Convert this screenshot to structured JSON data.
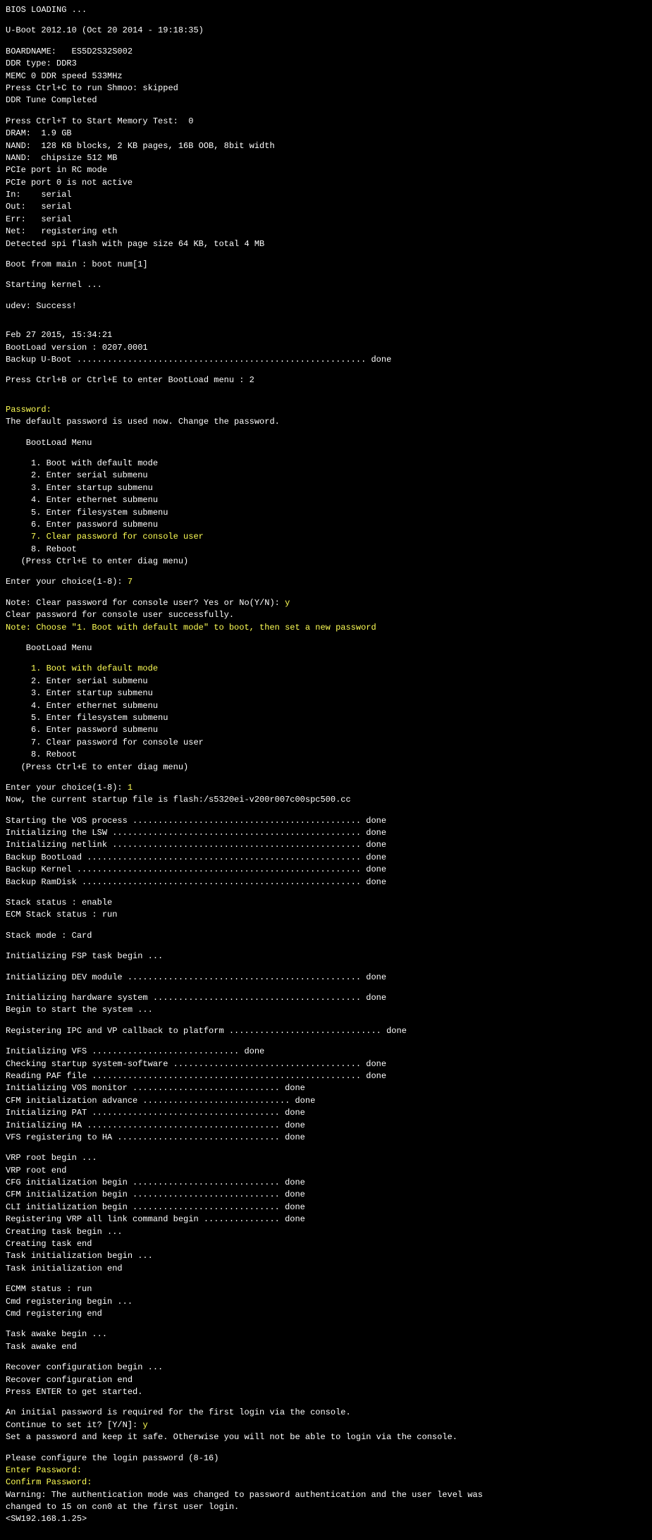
{
  "bios_loading": "BIOS LOADING ...",
  "uboot": "U-Boot 2012.10 (Oct 20 2014 - 19:18:35)",
  "boardname": "BOARDNAME:   ES5D2S32S002",
  "ddr_type": "DDR type: DDR3",
  "memc": "MEMC 0 DDR speed 533MHz",
  "press_ctrl_c": "Press Ctrl+C to run Shmoo: skipped",
  "ddr_tune": "DDR Tune Completed",
  "press_ctrl_t": "Press Ctrl+T to Start Memory Test:  0",
  "dram": "DRAM:  1.9 GB",
  "nand1": "NAND:  128 KB blocks, 2 KB pages, 16B OOB, 8bit width",
  "nand2": "NAND:  chipsize 512 MB",
  "pcie_rc": "PCIe port in RC mode",
  "pcie_inactive": "PCIe port 0 is not active",
  "in_serial": "In:    serial",
  "out_serial": "Out:   serial",
  "err_serial": "Err:   serial",
  "net": "Net:   registering eth",
  "spi_flash": "Detected spi flash with page size 64 KB, total 4 MB",
  "boot_from_main": "Boot from main : boot num[1]",
  "starting_kernel": "Starting kernel ...",
  "udev": "udev: Success!",
  "date": "Feb 27 2015, 15:34:21",
  "bootload_version": "BootLoad version : 0207.0001",
  "backup_uboot": "Backup U-Boot ......................................................... done",
  "press_ctrl_b": "Press Ctrl+B or Ctrl+E to enter BootLoad menu : 2",
  "password_label": "Password:",
  "default_password_msg": "The default password is used now. Change the password.",
  "bootload_menu_title": "BootLoad Menu",
  "menu1": {
    "i1": "1. Boot with default mode",
    "i2": "2. Enter serial submenu",
    "i3": "3. Enter startup submenu",
    "i4": "4. Enter ethernet submenu",
    "i5": "5. Enter filesystem submenu",
    "i6": "6. Enter password submenu",
    "i7": "7. Clear password for console user",
    "i8": "8. Reboot"
  },
  "press_ctrl_e": "(Press Ctrl+E to enter diag menu)",
  "choice1_prompt": "Enter your choice(1-8): ",
  "choice1_value": "7",
  "note_clear_prompt": "Note: Clear password for console user? Yes or No(Y/N): ",
  "note_clear_value": "y",
  "clear_success": "Clear password for console user successfully.",
  "note_choose": "Note: Choose \"1. Boot with default mode\" to boot, then set a new password",
  "menu2": {
    "i1": "1. Boot with default mode",
    "i2": "2. Enter serial submenu",
    "i3": "3. Enter startup submenu",
    "i4": "4. Enter ethernet submenu",
    "i5": "5. Enter filesystem submenu",
    "i6": "6. Enter password submenu",
    "i7": "7. Clear password for console user",
    "i8": "8. Reboot"
  },
  "choice2_prompt": "Enter your choice(1-8): ",
  "choice2_value": "1",
  "startup_file": "Now, the current startup file is flash:/s5320ei-v200r007c00spc500.cc",
  "vos_line": "Starting the VOS process ............................................. done",
  "lsw_line": "Initializing the LSW ................................................. done",
  "netlink_line": "Initializing netlink ................................................. done",
  "backup_bootload": "Backup BootLoad ...................................................... done",
  "backup_kernel": "Backup Kernel ........................................................ done",
  "backup_ramdisk": "Backup RamDisk ....................................................... done",
  "stack_status": "Stack status : enable",
  "ecm_stack": "ECM Stack status : run",
  "stack_mode": "Stack mode : Card",
  "fsp_begin": "Initializing FSP task begin ...",
  "dev_module": "Initializing DEV module .............................................. done",
  "hw_system": "Initializing hardware system ......................................... done",
  "begin_start": "Begin to start the system ...",
  "ipc_line": "Registering IPC and VP callback to platform .............................. done",
  "init_vfs": "Initializing VFS ............................. done",
  "check_startup": "Checking startup system-software ..................................... done",
  "reading_paf": "Reading PAF file ..................................................... done",
  "vos_monitor": "Initializing VOS monitor ............................. done",
  "cfm_advance": "CFM initialization advance ............................. done",
  "init_pat": "Initializing PAT ..................................... done",
  "init_ha": "Initializing HA ...................................... done",
  "vfs_reg": "VFS registering to HA ................................ done",
  "vrp_begin": "VRP root begin ...",
  "vrp_end": "VRP root end",
  "cfg_init": "CFG initialization begin ............................. done",
  "cfm_init": "CFM initialization begin ............................. done",
  "cli_init": "CLI initialization begin ............................. done",
  "register_vrp": "Registering VRP all link command begin ............... done",
  "create_task_begin": "Creating task begin ...",
  "create_task_end": "Creating task end",
  "task_init_begin": "Task initialization begin ...",
  "task_init_end": "Task initialization end",
  "ecmm_status": "ECMM status : run",
  "cmd_reg_begin": "Cmd registering begin ...",
  "cmd_reg_end": "Cmd registering end",
  "task_awake_begin": "Task awake begin ...",
  "task_awake_end": "Task awake end",
  "recover_begin": "Recover configuration begin ...",
  "recover_end": "Recover configuration end",
  "press_enter": "Press ENTER to get started.",
  "initial_pwd": "An initial password is required for the first login via the console.",
  "continue_prompt": "Continue to set it? [Y/N]: ",
  "continue_value": "y",
  "set_pwd_safe": "Set a password and keep it safe. Otherwise you will not be able to login via the console.",
  "please_configure": "Please configure the login password (8-16)",
  "enter_password": "Enter Password:",
  "confirm_password": "Confirm Password:",
  "warning1": "Warning: The authentication mode was changed to password authentication and the user level was",
  "warning2": "changed to 15 on con0 at the first user login.",
  "prompt": "<SW192.168.1.25>"
}
